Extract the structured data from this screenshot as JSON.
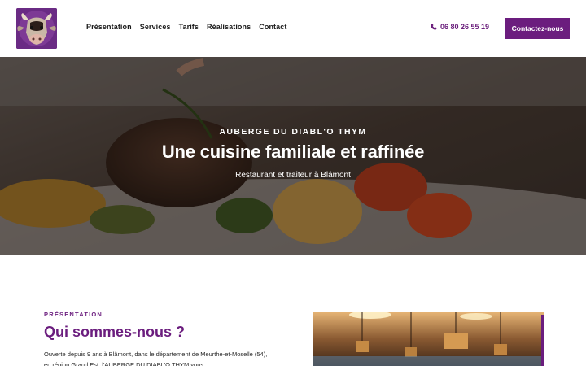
{
  "header": {
    "logo_alt": "Auberge du Diabl'o Thym",
    "nav": [
      {
        "label": "Présentation"
      },
      {
        "label": "Services"
      },
      {
        "label": "Tarifs"
      },
      {
        "label": "Réalisations"
      },
      {
        "label": "Contact"
      }
    ],
    "phone": "06 80 26 55 19",
    "cta_label": "Contactez-nous"
  },
  "hero": {
    "kicker": "AUBERGE DU DIABL'O THYM",
    "title": "Une cuisine familiale et raffinée",
    "subtitle": "Restaurant et traiteur à Blâmont"
  },
  "presentation": {
    "kicker": "PRÉSENTATION",
    "title": "Qui sommes-nous ?",
    "text": "Ouverte depuis 9 ans à Blâmont, dans le département de Meurthe-et-Moselle (54), en région Grand Est, l'AUBERGE DU DIABL'O THYM vous"
  },
  "colors": {
    "brand": "#6b1d7e",
    "white": "#ffffff"
  },
  "icons": {
    "phone": "phone-icon",
    "logo": "cow-logo-icon"
  }
}
